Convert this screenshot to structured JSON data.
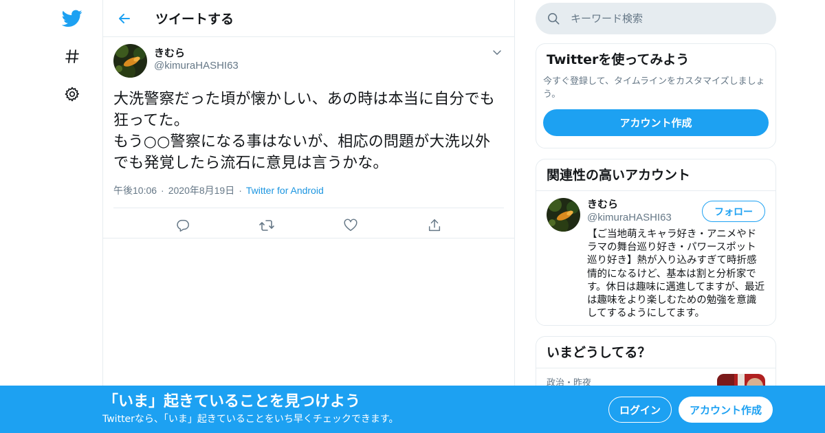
{
  "colors": {
    "accent": "#1da1f2",
    "secondary_text": "#657786",
    "border": "#e6ecf0"
  },
  "nav": {
    "icons": [
      "twitter-logo-icon",
      "hashtag-icon",
      "gear-icon"
    ]
  },
  "header": {
    "title": "ツイートする"
  },
  "tweet": {
    "author_name": "きむら",
    "author_handle": "@kimuraHASHI63",
    "text": "大洗警察だった頃が懐かしい、あの時は本当に自分でも狂ってた。\nもう○○警察になる事はないが、相応の問題が大洗以外でも発覚したら流石に意見は言うかな。",
    "time": "午後10:06",
    "date": "2020年8月19日",
    "source": "Twitter for Android",
    "dot": "·"
  },
  "search": {
    "placeholder": "キーワード検索"
  },
  "try_card": {
    "title": "Twitterを使ってみよう",
    "subtitle": "今すぐ登録して、タイムラインをカスタマイズしましょう。",
    "button": "アカウント作成"
  },
  "related_card": {
    "title": "関連性の高いアカウント",
    "user": {
      "name": "きむら",
      "handle": "@kimuraHASHI63",
      "follow_label": "フォロー",
      "bio": "【ご当地萌えキャラ好き・アニメやドラマの舞台巡り好き・パワースポット巡り好き】熱が入り込みすぎて時折感情的になるけど、基本は割と分析家です。休日は趣味に邁進してますが、最近は趣味をより楽しむための勉強を意識してするようにしてます。"
    }
  },
  "trend_card": {
    "title": "いまどうしてる？",
    "item_meta": "政治・昨夜"
  },
  "banner": {
    "title": "「いま」起きていることを見つけよう",
    "subtitle": "Twitterなら、「いま」起きていることをいち早くチェックできます。",
    "login": "ログイン",
    "signup": "アカウント作成"
  }
}
